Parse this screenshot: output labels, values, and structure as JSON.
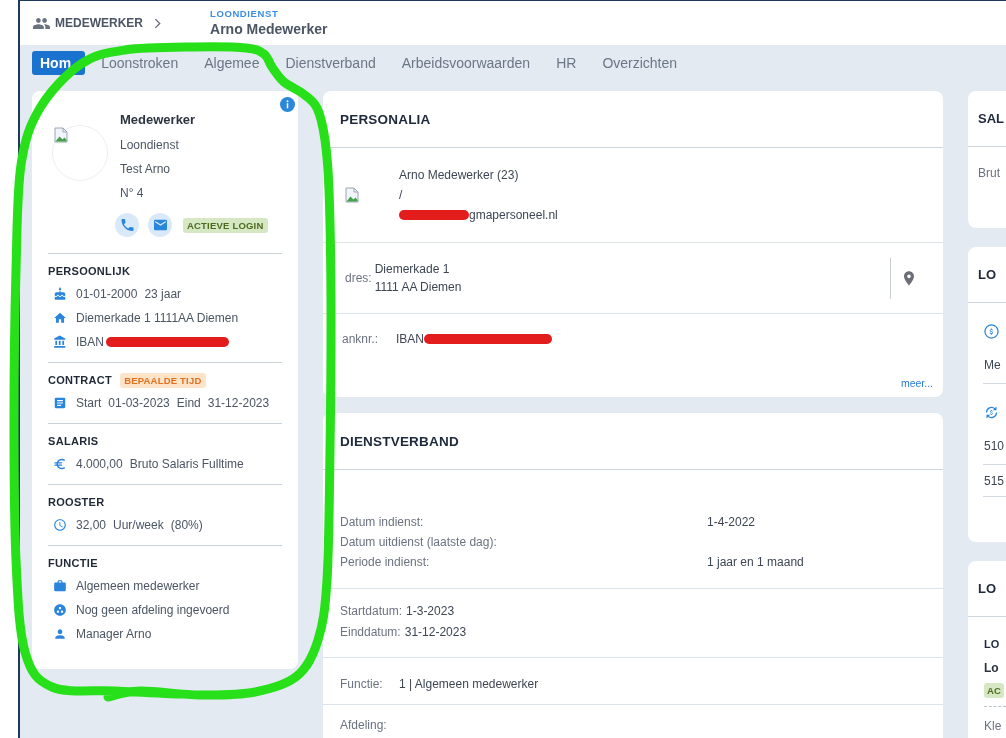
{
  "header": {
    "section": "MEDEWERKER",
    "category": "LOONDIENST",
    "employee_name": "Arno Medewerker"
  },
  "tabs": [
    {
      "label": "Hom",
      "selected": true
    },
    {
      "label": "Loonstroken",
      "selected": false
    },
    {
      "label": "Algemee",
      "selected": false
    },
    {
      "label": "Dienstverband",
      "selected": false
    },
    {
      "label": "Arbeidsvoorwaarden",
      "selected": false
    },
    {
      "label": "HR",
      "selected": false
    },
    {
      "label": "Overzichten",
      "selected": false
    }
  ],
  "profile_card": {
    "title": "Medewerker",
    "lines": [
      "Loondienst",
      "Test Arno",
      "N° 4"
    ],
    "actions": [
      {
        "kind": "call"
      },
      {
        "kind": "email"
      }
    ],
    "login_badge": "ACTIEVE LOGIN",
    "sections": [
      {
        "title": "PERSOONLIJK",
        "rows": [
          {
            "kind": "birth_date",
            "parts": [
              "01-01-2000",
              "23 jaar"
            ],
            "redacted": false
          },
          {
            "kind": "address",
            "parts": [
              "Diemerkade 1 1111AA Diemen"
            ],
            "redacted": false
          },
          {
            "kind": "bank_account",
            "parts": [
              "IBAN"
            ],
            "redacted": true
          }
        ]
      },
      {
        "title": "CONTRACT",
        "badge": "BEPAALDE TIJD",
        "rows": [
          {
            "kind": "contract_period",
            "parts": [
              "Start",
              "01-03-2023",
              "Eind",
              "31-12-2023"
            ],
            "redacted": false
          }
        ]
      },
      {
        "title": "SALARIS",
        "rows": [
          {
            "kind": "salary",
            "parts": [
              "4.000,00",
              "Bruto Salaris Fulltime"
            ],
            "redacted": false
          }
        ]
      },
      {
        "title": "ROOSTER",
        "rows": [
          {
            "kind": "working_hours",
            "parts": [
              "32,00",
              "Uur/week",
              "(80%)"
            ],
            "redacted": false
          }
        ]
      },
      {
        "title": "FUNCTIE",
        "rows": [
          {
            "kind": "job_title",
            "parts": [
              "Algemeen medewerker"
            ],
            "redacted": false
          },
          {
            "kind": "department",
            "parts": [
              "Nog geen afdeling ingevoerd"
            ],
            "redacted": false
          },
          {
            "kind": "manager",
            "parts": [
              "Manager Arno"
            ],
            "redacted": false
          }
        ]
      }
    ]
  },
  "personalia": {
    "title": "PERSONALIA",
    "lines": [
      {
        "text": "Arno Medewerker (23)",
        "redacted": false
      },
      {
        "text": "/",
        "redacted": false
      },
      {
        "text": "gmapersoneel.nl",
        "redacted": true
      }
    ],
    "address": {
      "label": "dres:",
      "lines": [
        "Diemerkade 1",
        "1111 AA Diemen"
      ]
    },
    "bank": {
      "label": "anknr.:",
      "value": "IBAN",
      "redacted": true
    },
    "more_link": "meer..."
  },
  "dienstverband": {
    "title": "DIENSTVERBAND",
    "period_rows": [
      {
        "label": "Datum indienst:",
        "value": "1-4-2022"
      },
      {
        "label": "Datum uitdienst (laatste dag):"
      },
      {
        "label": "Periode indienst:",
        "value": "1 jaar en 1 maand"
      }
    ],
    "contract_rows": [
      {
        "label": "Startdatum:",
        "value": "1-3-2023"
      },
      {
        "label": "Einddatum:",
        "value": "31-12-2023"
      }
    ],
    "function": {
      "label": "Functie:",
      "value": "1 | Algemeen medewerker"
    },
    "department": {
      "label": "Afdeling:"
    }
  },
  "right_cards": [
    {
      "kind": "summary",
      "title": "SAL",
      "text": "Brut"
    },
    {
      "kind": "list",
      "title": "LO",
      "items": [
        {
          "has_icon": true,
          "text": "Me"
        },
        {
          "has_icon": true,
          "text": "510"
        },
        {
          "has_icon": false,
          "text": "515"
        }
      ]
    },
    {
      "kind": "entry",
      "title": "LO",
      "entry_title": "LO",
      "entry_name": "Lo",
      "badge": "AC",
      "text": "Kle"
    }
  ]
}
